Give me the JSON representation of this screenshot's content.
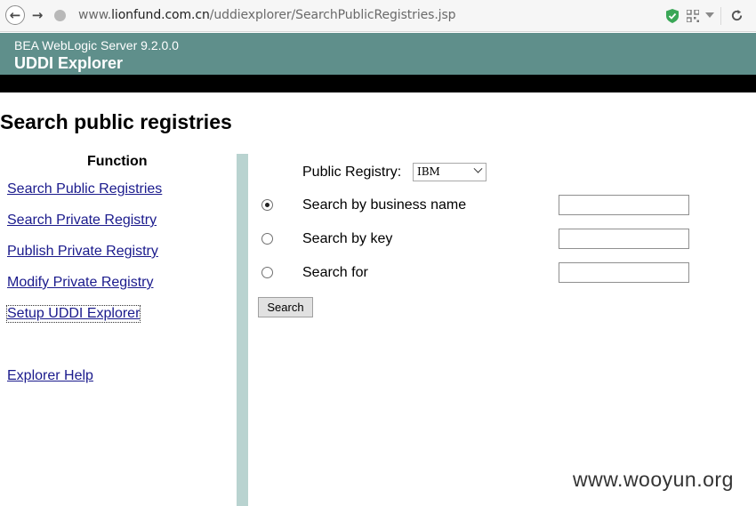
{
  "browser": {
    "url_prefix": "www.",
    "url_domain": "lionfund.com.cn",
    "url_path": "/uddiexplorer/SearchPublicRegistries.jsp",
    "back_icon": "arrow-left-icon",
    "forward_icon": "arrow-right-icon",
    "reload_icon": "reload-icon"
  },
  "header": {
    "product_version": "BEA WebLogic Server 9.2.0.0",
    "app_title": "UDDI Explorer",
    "bar_color": "#5f8f8b"
  },
  "page": {
    "title": "Search public registries"
  },
  "sidebar": {
    "heading": "Function",
    "links": [
      {
        "label": "Search Public Registries"
      },
      {
        "label": "Search Private Registry"
      },
      {
        "label": "Publish Private Registry"
      },
      {
        "label": "Modify Private Registry"
      },
      {
        "label": "Setup UDDI Explorer"
      }
    ],
    "help_link": "Explorer Help",
    "link_color": "#1a1a8c",
    "divider_color": "#b9d3d0"
  },
  "form": {
    "registry_label": "Public Registry:",
    "registry_selected": "IBM",
    "options": [
      {
        "label": "Search by business name",
        "checked": true,
        "value": ""
      },
      {
        "label": "Search by key",
        "checked": false,
        "value": ""
      },
      {
        "label": "Search for",
        "checked": false,
        "value": ""
      }
    ],
    "search_button": "Search"
  },
  "watermark": "www.wooyun.org"
}
